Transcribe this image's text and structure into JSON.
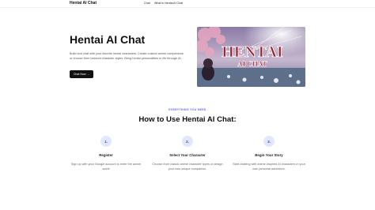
{
  "nav": {
    "brand": "Hentai AI Chat",
    "links": [
      "Chat",
      "What is Hentai AI Chat"
    ]
  },
  "hero": {
    "title": "Hentai AI Chat",
    "description": "Build and chat with your favorite hentai characters. Create custom anime companions or choose from beloved character styles. Bring hentai personalities to life through AI.",
    "cta_label": "Chat Now",
    "cta_arrow": "→",
    "image_text_line1": "HENTAI",
    "image_text_line2": "AI CHAT"
  },
  "how_to": {
    "eyebrow": "EVERYTHING YOU NEED",
    "title": "How to Use Hentai AI Chat:",
    "steps": [
      {
        "num": "1.",
        "title": "Register",
        "desc": "Sign up with your Google account to enter the anime world"
      },
      {
        "num": "2.",
        "title": "Select Your Character",
        "desc": "Choose from classic anime character types or design your own unique companion."
      },
      {
        "num": "3.",
        "title": "Begin Your Story",
        "desc": "Start chatting with anime-inspired AI characters in your own personal adventure."
      }
    ]
  },
  "colors": {
    "accent": "#6366f1",
    "button_bg": "#111111",
    "step_circle": "#e0e7ff"
  }
}
